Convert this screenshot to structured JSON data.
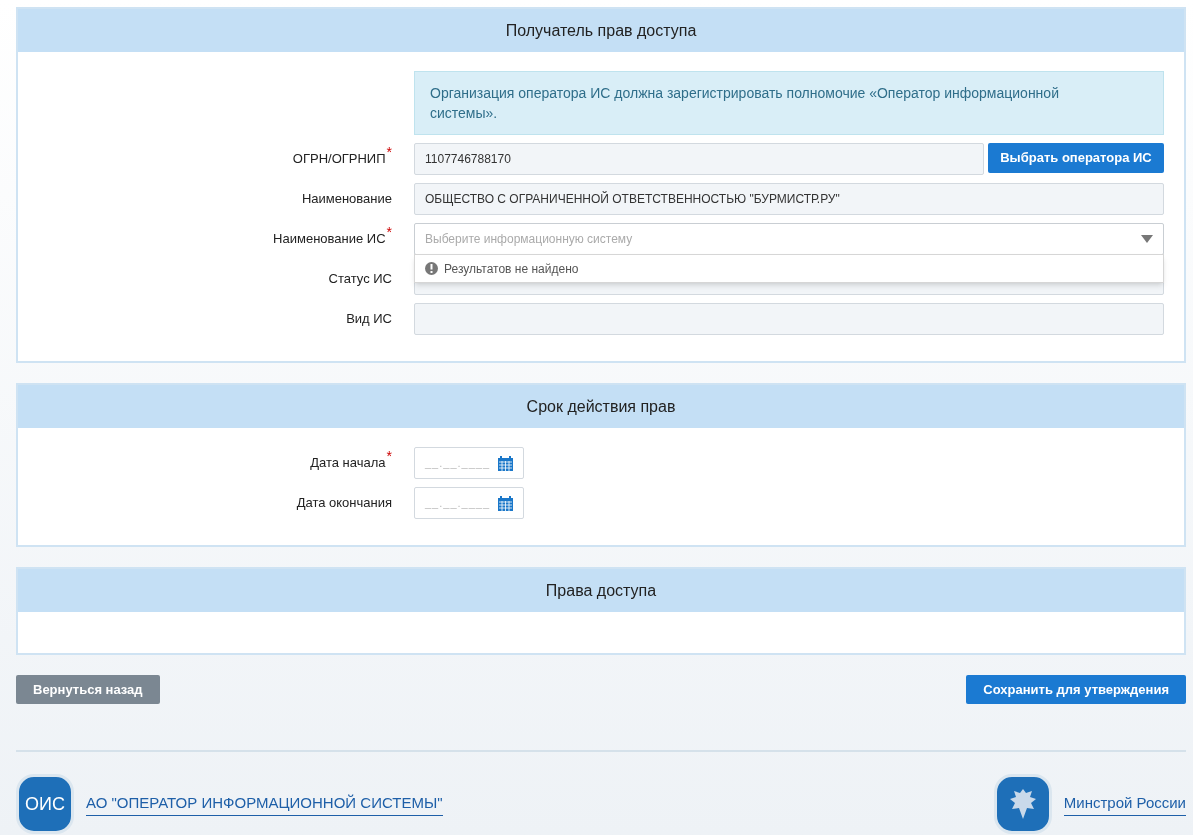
{
  "recipient": {
    "title": "Получатель прав доступа",
    "notice": "Организация оператора ИС должна зарегистрировать полномочие «Оператор информационной системы».",
    "fields": [
      {
        "kind": "text",
        "label": "ОГРН/ОГРНИП",
        "required_mark": "*",
        "value": "1107746788170",
        "button": "Выбрать оператора ИС"
      },
      {
        "kind": "text",
        "label": "Наименование",
        "value": "ОБЩЕСТВО С ОГРАНИЧЕННОЙ ОТВЕТСТВЕННОСТЬЮ \"БУРМИСТР.РУ\""
      },
      {
        "kind": "select",
        "label": "Наименование ИС",
        "required_mark": "*",
        "placeholder": "Выберите информационную систему",
        "expanded": true,
        "message": "Результатов не найдено"
      },
      {
        "kind": "text",
        "label": "Статус ИС"
      },
      {
        "kind": "text",
        "label": "Вид ИС"
      }
    ]
  },
  "validity": {
    "title": "Срок действия прав",
    "fields": [
      {
        "kind": "date",
        "label": "Дата начала",
        "required_mark": "*",
        "placeholder": "__.__.____"
      },
      {
        "kind": "date",
        "label": "Дата окончания",
        "placeholder": "__.__.____"
      }
    ]
  },
  "access": {
    "title": "Права доступа"
  },
  "actions": {
    "back": "Вернуться назад",
    "save": "Сохранить для утверждения"
  },
  "footer": {
    "left": {
      "badge": "ОИС",
      "link": "АО \"ОПЕРАТОР ИНФОРМАЦИОННОЙ СИСТЕМЫ\""
    },
    "right": {
      "link": "Минстрой России"
    }
  }
}
